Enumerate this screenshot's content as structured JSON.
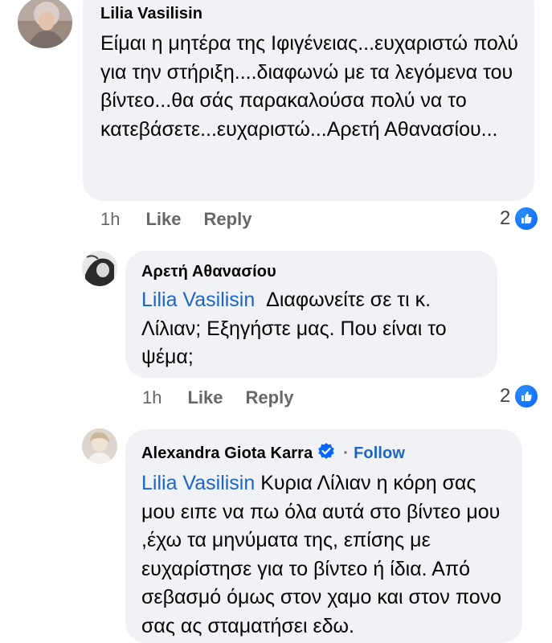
{
  "comments": [
    {
      "author": "Lilia Vasilisin",
      "text": "Είμαι  η μητέρα της  Ιφιγένειας...ευχαριστώ πολύ για την στήριξη....διαφωνώ με τα λεγόμενα του  βίντεο...θα  σάς παρακαλούσα πολύ να το κατεβάσετε...ευχαριστώ...Αρετή Αθανασίου...",
      "time": "1h",
      "like_label": "Like",
      "reply_label": "Reply",
      "reaction_count": "2"
    },
    {
      "author": "Αρετή Αθανασίου",
      "mention": "Lilia Vasilisin",
      "text": "Διαφωνείτε σε τι κ. Λίλιαν;  Εξηγήστε μας. Που είναι το ψέμα;",
      "time": "1h",
      "like_label": "Like",
      "reply_label": "Reply",
      "reaction_count": "2"
    },
    {
      "author": "Alexandra Giota Karra",
      "follow_label": "Follow",
      "separator": "·",
      "mention": "Lilia Vasilisin",
      "text": "Κυρια Λίλιαν η κόρη σας μου ειπε να πω όλα αυτά στο βίντεο μου ,έχω τα μηνύματα της, επίσης με ευχαρίστησε για το βίντεο ή ίδια. Από σεβασμό όμως στον χαμο και στον πονο σας ας σταματήσει εδω."
    }
  ],
  "colors": {
    "bubble": "#f0f2f5",
    "mention": "#1b65c6",
    "like_badge": "#0866ff",
    "muted_text": "#65676b"
  },
  "icons": [
    "like-icon",
    "verified-badge-icon"
  ]
}
